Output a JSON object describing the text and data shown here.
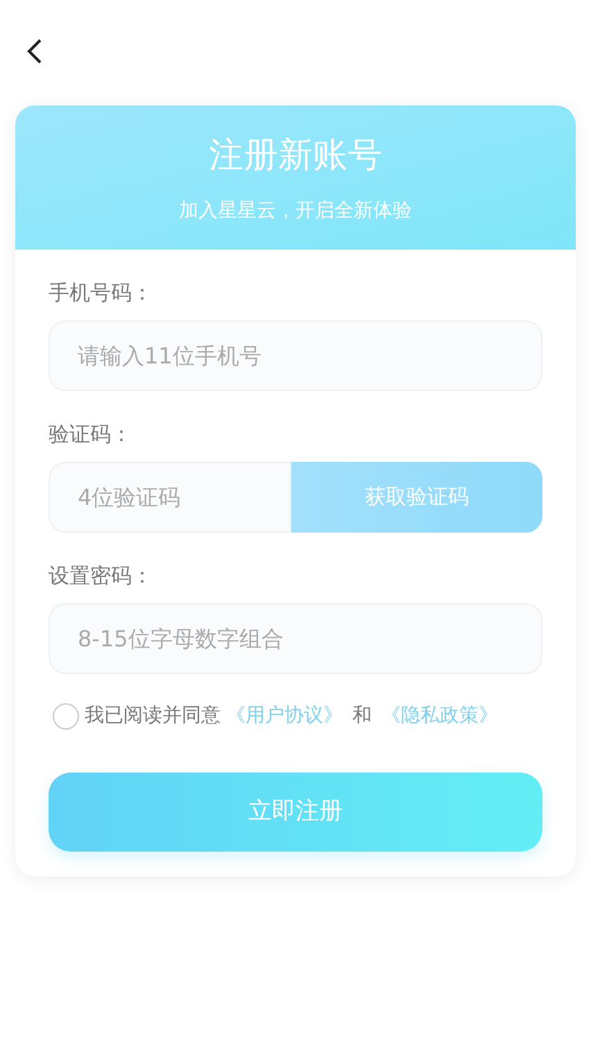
{
  "header": {
    "title": "注册新账号",
    "subtitle": "加入星星云，开启全新体验"
  },
  "fields": [
    {
      "kind": "input",
      "label": "手机号码：",
      "placeholder": "请输入11位手机号"
    },
    {
      "kind": "code",
      "label": "验证码：",
      "placeholder": "4位验证码",
      "button": "获取验证码"
    },
    {
      "kind": "input",
      "label": "设置密码：",
      "placeholder": "8-15位字母数字组合"
    }
  ],
  "agreement": {
    "checked": false,
    "text": "我已阅读并同意",
    "link_1": "《用户协议》",
    "joiner": "和",
    "link_2": "《隐私政策》"
  },
  "submit": "立即注册"
}
